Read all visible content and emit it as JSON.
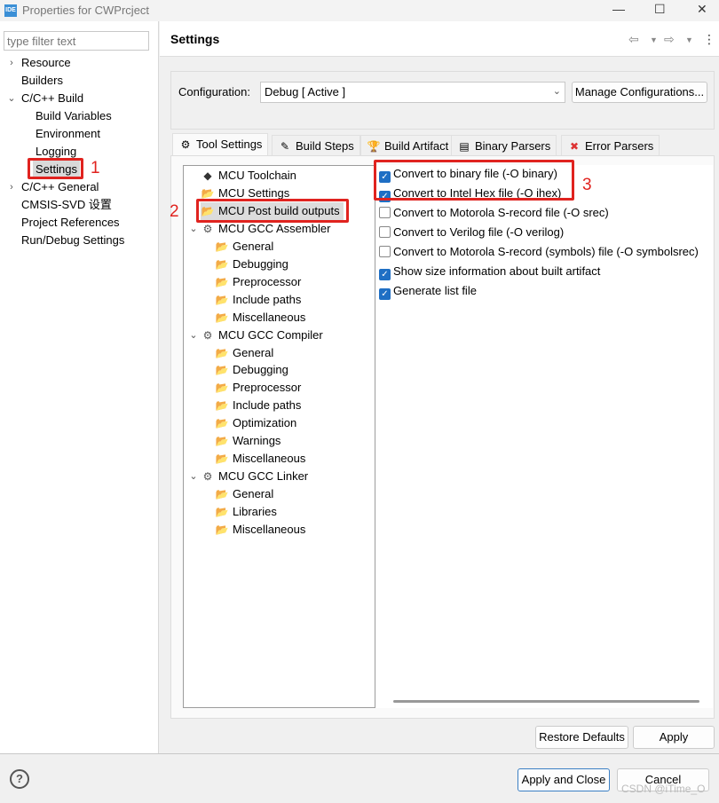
{
  "window": {
    "title": "Properties for CWPrcject",
    "app_icon": "IDE",
    "minimize": "—",
    "maximize": "☐",
    "close": "✕"
  },
  "filter": {
    "placeholder": "type filter text"
  },
  "left_tree": [
    {
      "label": "Resource",
      "level": 0,
      "chevron": "›"
    },
    {
      "label": "Builders",
      "level": 0,
      "chevron": ""
    },
    {
      "label": "C/C++ Build",
      "level": 0,
      "chevron": "⌄"
    },
    {
      "label": "Build Variables",
      "level": 1,
      "chevron": ""
    },
    {
      "label": "Environment",
      "level": 1,
      "chevron": ""
    },
    {
      "label": "Logging",
      "level": 1,
      "chevron": ""
    },
    {
      "label": "Settings",
      "level": 1,
      "chevron": "",
      "selected": true
    },
    {
      "label": "C/C++ General",
      "level": 0,
      "chevron": "›"
    },
    {
      "label": "CMSIS-SVD 设置",
      "level": 0,
      "chevron": ""
    },
    {
      "label": "Project References",
      "level": 0,
      "chevron": ""
    },
    {
      "label": "Run/Debug Settings",
      "level": 0,
      "chevron": ""
    }
  ],
  "header": {
    "title": "Settings",
    "back_icon": "⇦",
    "forward_icon": "⇨",
    "menu_icon": "⋮"
  },
  "configuration": {
    "label": "Configuration:",
    "value": "Debug  [ Active ]",
    "manage_label": "Manage Configurations..."
  },
  "tabs": [
    {
      "label": "Tool Settings",
      "icon": "⚙",
      "active": true
    },
    {
      "label": "Build Steps",
      "icon": "✎"
    },
    {
      "label": "Build Artifact",
      "icon": "🏆"
    },
    {
      "label": "Binary Parsers",
      "icon": "▤"
    },
    {
      "label": "Error Parsers",
      "icon": "✖"
    }
  ],
  "tool_tree": [
    {
      "label": "MCU Toolchain",
      "level": 0,
      "icon": "chip"
    },
    {
      "label": "MCU Settings",
      "level": 0,
      "icon": "folder"
    },
    {
      "label": "MCU Post build outputs",
      "level": 0,
      "icon": "folder",
      "selected": true
    },
    {
      "label": "MCU GCC Assembler",
      "level": 0,
      "icon": "gear",
      "expanded": true
    },
    {
      "label": "General",
      "level": 1,
      "icon": "folder"
    },
    {
      "label": "Debugging",
      "level": 1,
      "icon": "folder"
    },
    {
      "label": "Preprocessor",
      "level": 1,
      "icon": "folder"
    },
    {
      "label": "Include paths",
      "level": 1,
      "icon": "folder"
    },
    {
      "label": "Miscellaneous",
      "level": 1,
      "icon": "folder"
    },
    {
      "label": "MCU GCC Compiler",
      "level": 0,
      "icon": "gear",
      "expanded": true
    },
    {
      "label": "General",
      "level": 1,
      "icon": "folder"
    },
    {
      "label": "Debugging",
      "level": 1,
      "icon": "folder"
    },
    {
      "label": "Preprocessor",
      "level": 1,
      "icon": "folder"
    },
    {
      "label": "Include paths",
      "level": 1,
      "icon": "folder"
    },
    {
      "label": "Optimization",
      "level": 1,
      "icon": "folder"
    },
    {
      "label": "Warnings",
      "level": 1,
      "icon": "folder"
    },
    {
      "label": "Miscellaneous",
      "level": 1,
      "icon": "folder"
    },
    {
      "label": "MCU GCC Linker",
      "level": 0,
      "icon": "gear",
      "expanded": true
    },
    {
      "label": "General",
      "level": 1,
      "icon": "folder"
    },
    {
      "label": "Libraries",
      "level": 1,
      "icon": "folder"
    },
    {
      "label": "Miscellaneous",
      "level": 1,
      "icon": "folder"
    }
  ],
  "options": [
    {
      "label": "Convert to binary file (-O binary)",
      "checked": true
    },
    {
      "label": "Convert to Intel Hex file (-O ihex)",
      "checked": true
    },
    {
      "label": "Convert to Motorola S-record file (-O srec)",
      "checked": false
    },
    {
      "label": "Convert to Verilog file (-O verilog)",
      "checked": false
    },
    {
      "label": "Convert to Motorola S-record (symbols) file (-O symbolsrec)",
      "checked": false
    },
    {
      "label": "Show size information about built artifact",
      "checked": true
    },
    {
      "label": "Generate list file",
      "checked": true
    }
  ],
  "buttons": {
    "restore": "Restore Defaults",
    "apply": "Apply",
    "apply_close": "Apply and Close",
    "cancel": "Cancel",
    "help": "?"
  },
  "annotations": {
    "n1": "1",
    "n2": "2",
    "n3": "3",
    "color": "#e0231f"
  },
  "watermark": "CSDN @iTime_O"
}
